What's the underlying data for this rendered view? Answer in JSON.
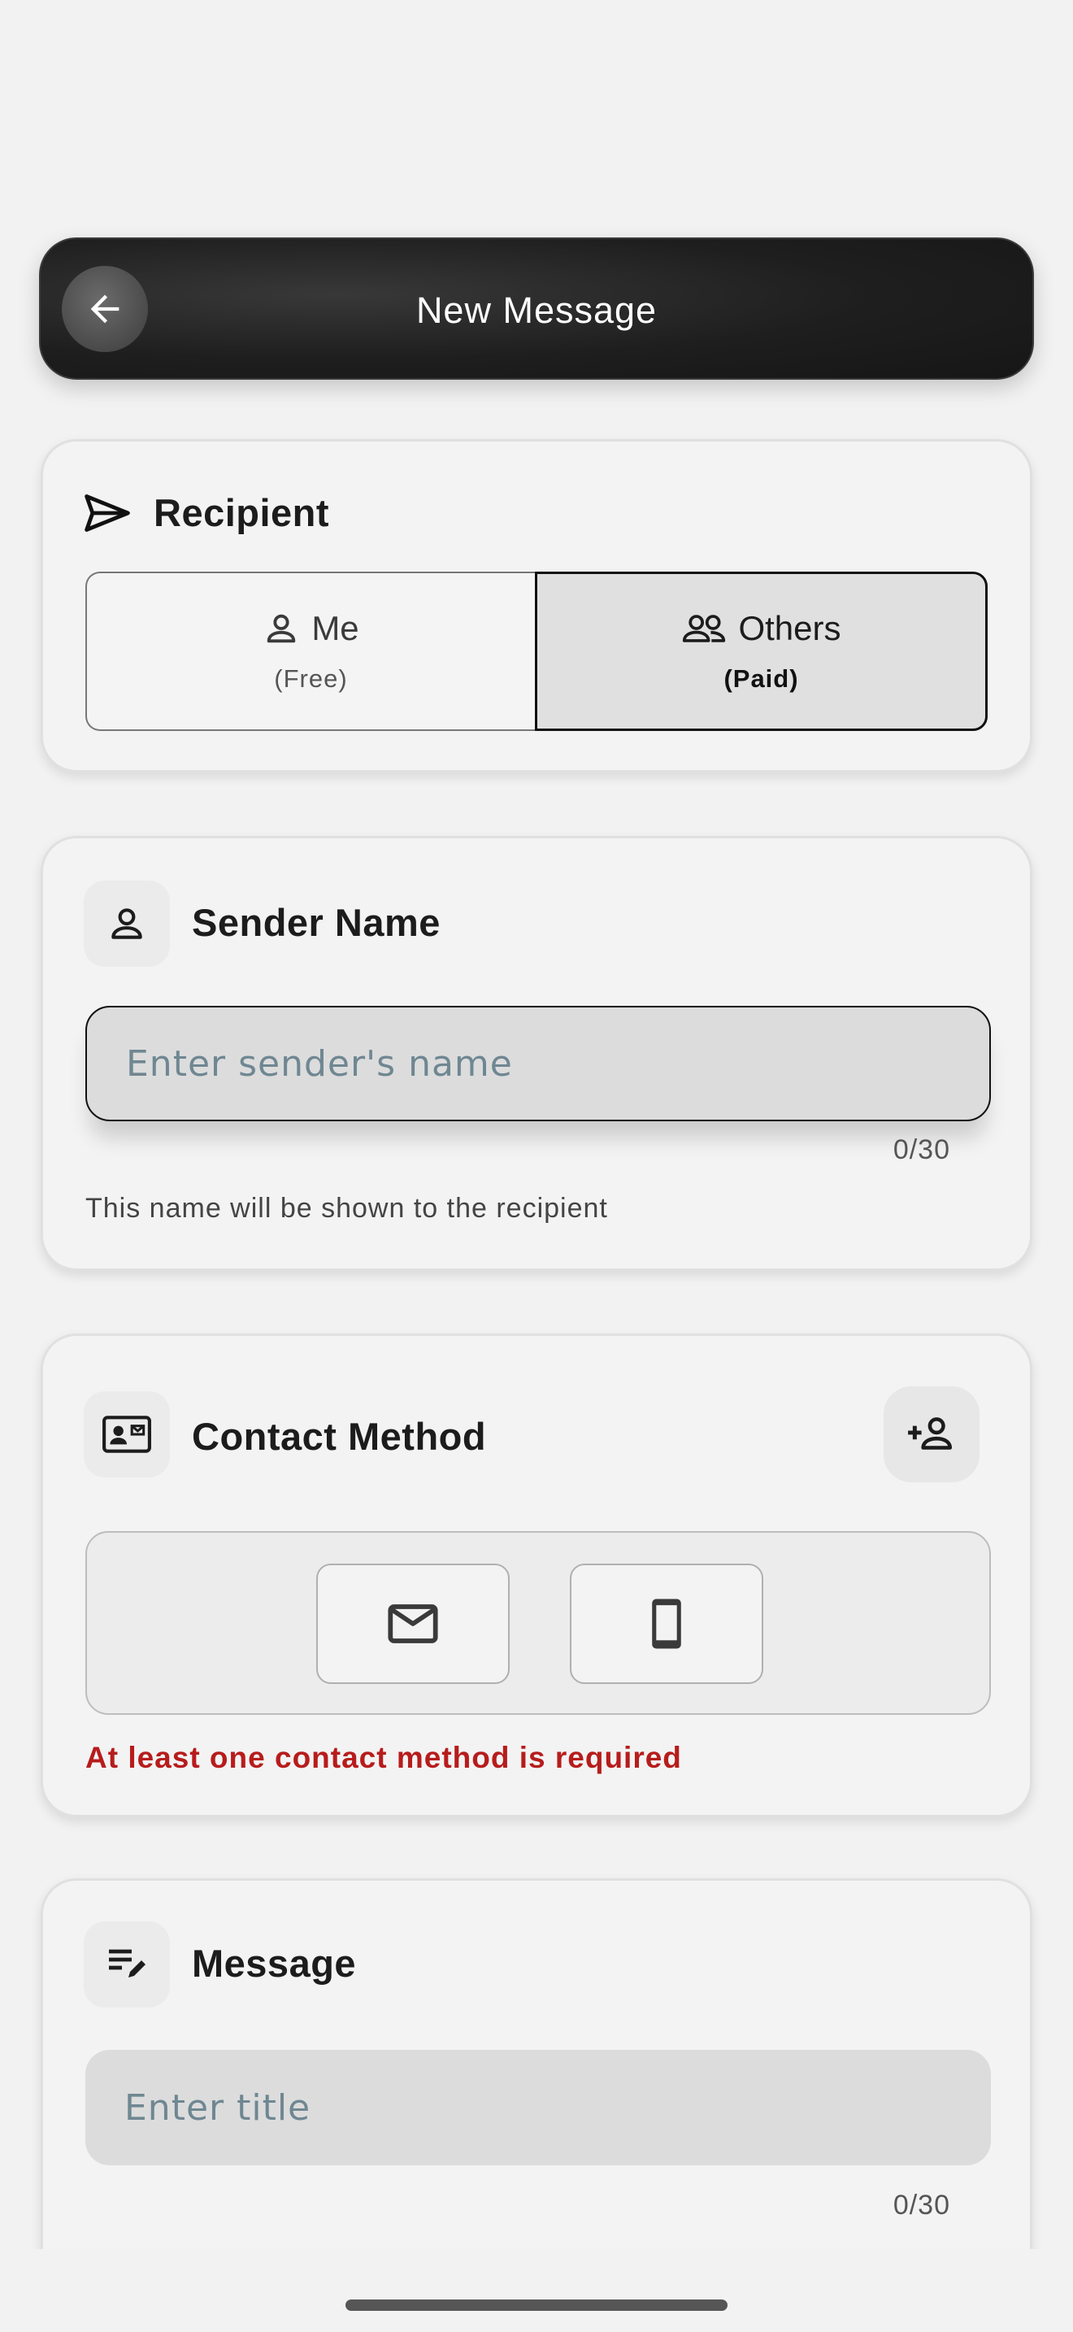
{
  "appbar": {
    "title": "New Message"
  },
  "recipient": {
    "title": "Recipient",
    "options": [
      {
        "label": "Me",
        "sub": "(Free)",
        "selected": false
      },
      {
        "label": "Others",
        "sub": "(Paid)",
        "selected": true
      }
    ]
  },
  "sender": {
    "title": "Sender Name",
    "placeholder": "Enter sender's name",
    "counter": "0/30",
    "helper": "This name will be shown to the recipient"
  },
  "contact": {
    "title": "Contact Method",
    "methods": [
      "mail-icon",
      "phone-icon"
    ],
    "error": "At least one contact method is required"
  },
  "message": {
    "title": "Message",
    "title_placeholder": "Enter title",
    "counter": "0/30"
  },
  "colors": {
    "error": "#b71c1c",
    "appbar": "#1e1e1e",
    "background": "#f2f2f2"
  }
}
